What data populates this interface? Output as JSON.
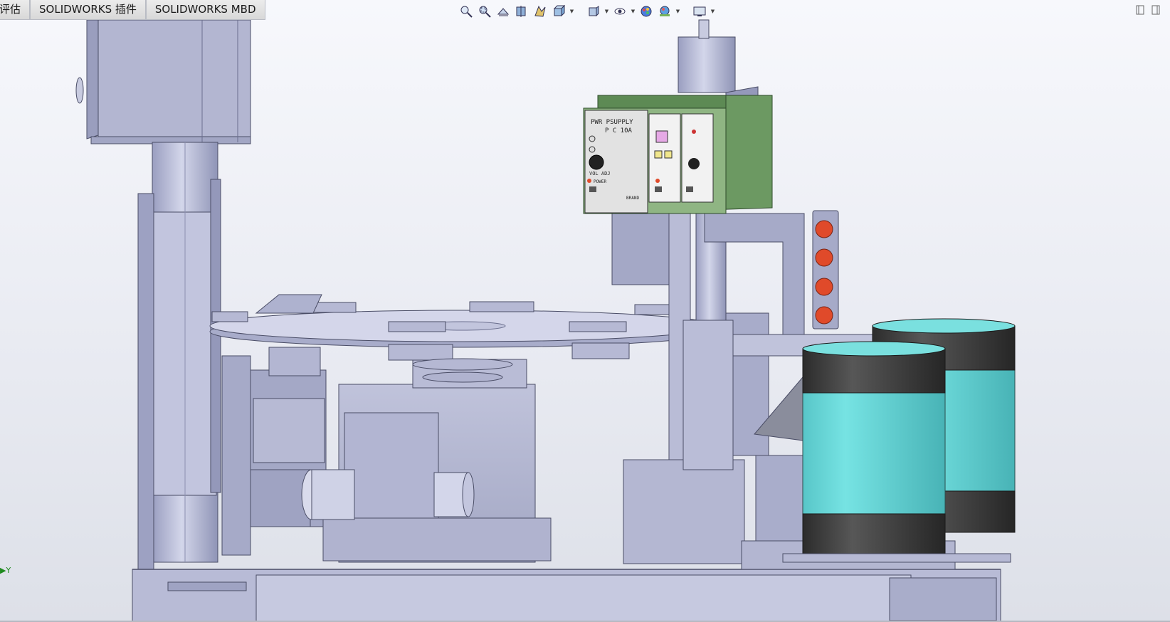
{
  "tabs": [
    {
      "label": "评估"
    },
    {
      "label": "SOLIDWORKS 插件"
    },
    {
      "label": "SOLIDWORKS MBD"
    }
  ],
  "heads_up_toolbar": [
    {
      "name": "zoom-to-fit-icon"
    },
    {
      "name": "zoom-to-area-icon"
    },
    {
      "name": "previous-view-icon"
    },
    {
      "name": "section-view-icon"
    },
    {
      "name": "dynamic-annotation-views-icon"
    },
    {
      "name": "view-orientation-icon"
    },
    {
      "name": "display-style-icon"
    },
    {
      "name": "hide-show-items-icon"
    },
    {
      "name": "edit-appearance-icon"
    },
    {
      "name": "apply-scene-icon"
    },
    {
      "name": "view-settings-icon"
    }
  ],
  "model": {
    "controller_label_1": "PWR PSUPPLY",
    "controller_label_2": "P C 10A",
    "controller_dial_label": "VOL ADJ",
    "controller_power_label": "POWER",
    "controller_brand": "BRAND"
  },
  "triad": {
    "axis_label": "Y"
  },
  "colors": {
    "metal": "#aeb2cf",
    "metal_dark": "#8a8fb0",
    "metal_light": "#c9cce2",
    "green_panel": "#6f9b64",
    "teal": "#5fd0d0",
    "black_band": "#3c3c3c",
    "red_lamp": "#e04a2a"
  }
}
